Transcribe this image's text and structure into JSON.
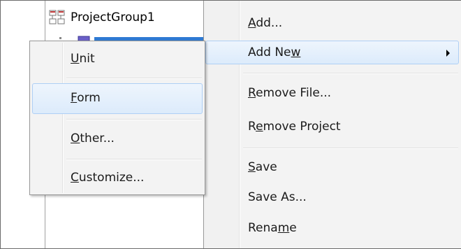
{
  "tree": {
    "root_label": "ProjectGroup1",
    "root_icon": "project-group-icon"
  },
  "context_menu": {
    "items": [
      {
        "pre": "",
        "key": "A",
        "post": "dd..."
      },
      {
        "pre": "Add Ne",
        "key": "w",
        "post": ""
      },
      {
        "pre": "",
        "key": "R",
        "post": "emove File..."
      },
      {
        "pre": "R",
        "key": "e",
        "post": "move Project"
      },
      {
        "pre": "",
        "key": "S",
        "post": "ave"
      },
      {
        "pre": "Save As...",
        "key": "",
        "post": ""
      },
      {
        "pre": "Rena",
        "key": "m",
        "post": "e"
      }
    ]
  },
  "submenu": {
    "items": [
      {
        "pre": "",
        "key": "U",
        "post": "nit"
      },
      {
        "pre": "",
        "key": "F",
        "post": "orm"
      },
      {
        "pre": "",
        "key": "O",
        "post": "ther..."
      },
      {
        "pre": "",
        "key": "C",
        "post": "ustomize..."
      }
    ]
  },
  "colors": {
    "menu_bg": "#f3f3f3",
    "hover_border": "#aecff5",
    "selection": "#2f7ad3"
  }
}
